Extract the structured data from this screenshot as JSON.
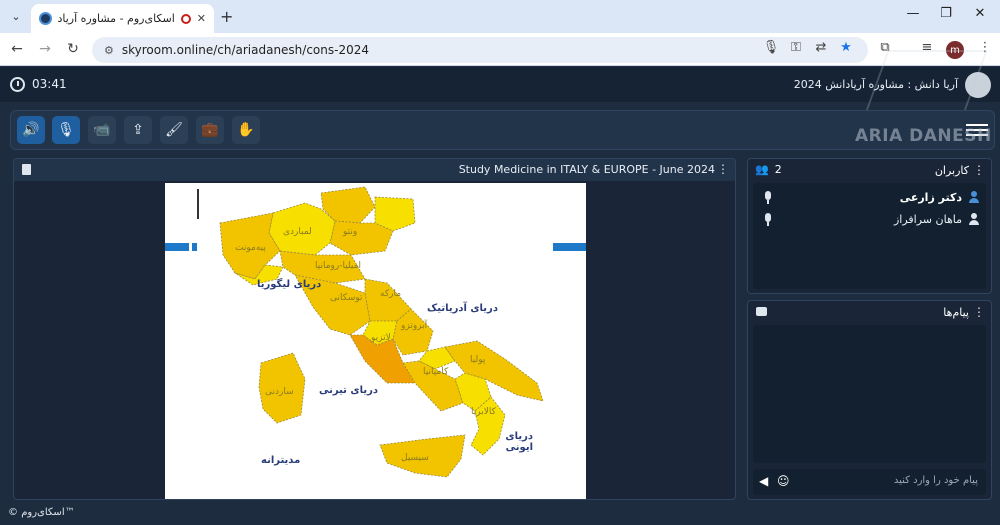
{
  "browser": {
    "tab_title": "اسکای‌روم - مشاوره آریادانش",
    "tab_close": "✕",
    "new_tab": "+",
    "url": "skyroom.online/ch/ariadanesh/cons-2024",
    "profile_initial": "m",
    "win_minimize": "—",
    "win_restore": "❐",
    "win_close": "✕",
    "back": "←",
    "forward": "→",
    "reload": "↻",
    "tab_search": "⌄"
  },
  "app": {
    "timer": "03:41",
    "room_title": "آریا دانش : مشاوره آریادانش 2024",
    "watermark": "ARIA DANESH"
  },
  "controls": [
    {
      "name": "speaker-button",
      "icon": "speaker-icon",
      "glyph": "🔊",
      "active": true
    },
    {
      "name": "mic-button",
      "icon": "mic-icon",
      "glyph": "🎙",
      "active": true
    },
    {
      "name": "camera-off-button",
      "icon": "camera-off-icon",
      "glyph": "📹",
      "active": false
    },
    {
      "name": "screen-share-button",
      "icon": "screen-share-icon",
      "glyph": "⇪",
      "active": false
    },
    {
      "name": "whiteboard-button",
      "icon": "brush-icon",
      "glyph": "🖌",
      "active": false
    },
    {
      "name": "files-button",
      "icon": "briefcase-icon",
      "glyph": "💼",
      "active": false
    },
    {
      "name": "raise-hand-button",
      "icon": "hand-icon",
      "glyph": "✋",
      "active": false
    }
  ],
  "stage": {
    "title": "Study Medicine in ITALY & EUROPE - June 2024",
    "menu": "⋮"
  },
  "slide_map": {
    "sea_labels": [
      "دریای آدریاتیک",
      "دریای لیگوریا",
      "دریای تیرنی",
      "دریای ایونی",
      "مدیترانه"
    ],
    "regions": [
      "ترنتینو آلتو آدیجه",
      "فریولی ونیزیا",
      "ونتو",
      "لمباردی",
      "پیه‌مونت",
      "لیگوریا",
      "امیلیا-رومانیا",
      "توسکانی",
      "مارکه",
      "اومبریا",
      "آبروتزو",
      "لاتزیو",
      "مولیزه",
      "کامپانیا",
      "پولیا",
      "بازیلیکاتا",
      "کالابریا",
      "سیسیل",
      "ساردنی"
    ]
  },
  "users": {
    "title": "کاربران",
    "count": "2",
    "list": [
      {
        "name": "دکتر زارعی",
        "bold": true,
        "color": "#4a90d9"
      },
      {
        "name": "ماهان سرافراز",
        "bold": false,
        "color": "#dfe6ee"
      }
    ]
  },
  "messages": {
    "title": "پیام‌ها",
    "placeholder": "پیام خود را وارد کنید",
    "send": "◀",
    "emoji": "☺"
  },
  "footer": {
    "brand": "© اسکای‌روم™"
  }
}
